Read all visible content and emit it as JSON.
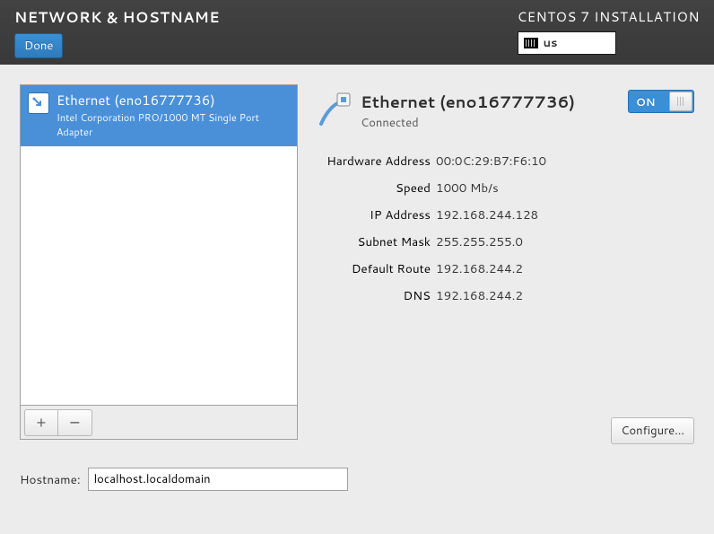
{
  "header": {
    "title": "NETWORK & HOSTNAME",
    "subtitle": "CENTOS 7 INSTALLATION",
    "locale": "us",
    "done_label": "Done"
  },
  "nic_list": [
    {
      "title": "Ethernet (eno16777736)",
      "subtitle": "Intel Corporation PRO/1000 MT Single Port Adapter"
    }
  ],
  "toolbar": {
    "add": "+",
    "remove": "−"
  },
  "connection": {
    "title": "Ethernet (eno16777736)",
    "status": "Connected",
    "toggle_label": "ON",
    "details": {
      "hardware_address_label": "Hardware Address",
      "hardware_address": "00:0C:29:B7:F6:10",
      "speed_label": "Speed",
      "speed": "1000 Mb/s",
      "ip_label": "IP Address",
      "ip": "192.168.244.128",
      "subnet_label": "Subnet Mask",
      "subnet": "255.255.255.0",
      "route_label": "Default Route",
      "route": "192.168.244.2",
      "dns_label": "DNS",
      "dns": "192.168.244.2"
    }
  },
  "buttons": {
    "configure": "Configure..."
  },
  "hostname": {
    "label": "Hostname:",
    "value": "localhost.localdomain"
  }
}
